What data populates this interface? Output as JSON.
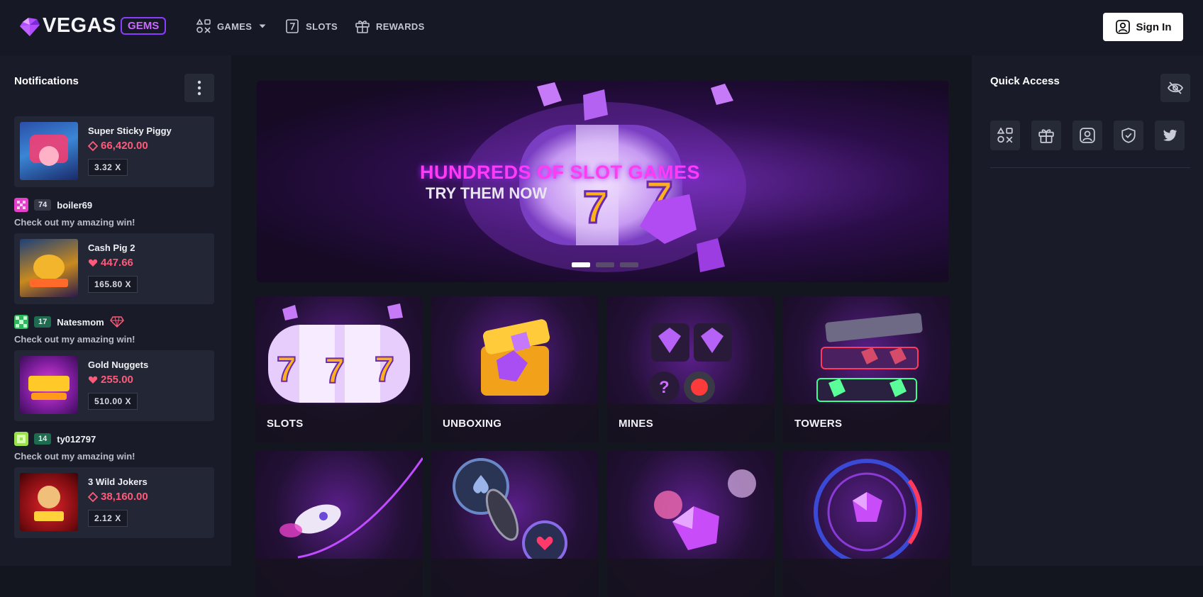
{
  "header": {
    "logo_text": "VEGAS",
    "logo_badge": "GEMS",
    "nav": [
      {
        "label": "GAMES",
        "icon": "games-icon"
      },
      {
        "label": "SLOTS",
        "icon": "slots-icon"
      },
      {
        "label": "REWARDS",
        "icon": "gift-icon"
      }
    ],
    "signin_label": "Sign In"
  },
  "notifications": {
    "title": "Notifications",
    "items": [
      {
        "game": "Super Sticky Piggy",
        "amount": "66,420.00",
        "multiplier": "3.32 X",
        "currency": "diamond-outline"
      },
      {
        "user": "boiler69",
        "level": "74",
        "message": "Check out my amazing win!",
        "game": "Cash Pig 2",
        "amount": "447.66",
        "multiplier": "165.80 X",
        "currency": "heart"
      },
      {
        "user": "Natesmom",
        "level": "17",
        "message": "Check out my amazing win!",
        "game": "Gold Nuggets",
        "amount": "255.00",
        "multiplier": "510.00 X",
        "currency": "heart"
      },
      {
        "user": "ty012797",
        "level": "14",
        "message": "Check out my amazing win!",
        "game": "3 Wild Jokers",
        "amount": "38,160.00",
        "multiplier": "2.12 X",
        "currency": "diamond-outline"
      }
    ]
  },
  "banner": {
    "title": "HUNDREDS OF SLOT GAMES",
    "subtitle": "TRY THEM NOW",
    "slides": 3,
    "active_slide": 0
  },
  "tiles": [
    {
      "label": "SLOTS"
    },
    {
      "label": "UNBOXING"
    },
    {
      "label": "MINES"
    },
    {
      "label": "TOWERS"
    },
    {
      "label": ""
    },
    {
      "label": ""
    },
    {
      "label": ""
    },
    {
      "label": ""
    }
  ],
  "quick_access": {
    "title": "Quick Access",
    "buttons": [
      "games-icon",
      "gift-icon",
      "profile-icon",
      "shield-icon",
      "twitter-icon"
    ]
  },
  "colors": {
    "accent_pink": "#ff5a7a",
    "accent_purple": "#8b3dff",
    "bg": "#13151f"
  }
}
